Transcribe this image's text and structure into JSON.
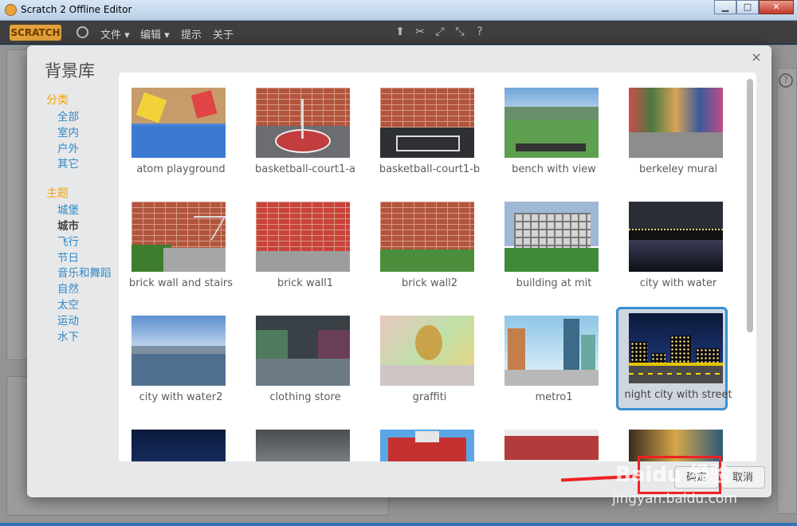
{
  "window": {
    "title": "Scratch 2 Offline Editor",
    "min": "▁",
    "max": "□",
    "close": "✕"
  },
  "menubar": {
    "logo": "SCRATCH",
    "items": [
      "文件 ▾",
      "编辑 ▾",
      "提示",
      "关于"
    ]
  },
  "dialog": {
    "title": "背景库",
    "close": "×",
    "categories_header": "分类",
    "categories": [
      "全部",
      "室内",
      "户外",
      "其它"
    ],
    "themes_header": "主题",
    "themes": [
      "城堡",
      "城市",
      "飞行",
      "节日",
      "音乐和舞蹈",
      "自然",
      "太空",
      "运动",
      "水下"
    ],
    "active_theme": "城市",
    "ok_label": "确定",
    "cancel_label": "取消"
  },
  "tiles": [
    {
      "label": "atom playground"
    },
    {
      "label": "basketball-court1-a"
    },
    {
      "label": "basketball-court1-b"
    },
    {
      "label": "bench with view"
    },
    {
      "label": "berkeley mural"
    },
    {
      "label": "brick wall and stairs"
    },
    {
      "label": "brick wall1"
    },
    {
      "label": "brick wall2"
    },
    {
      "label": "building at mit"
    },
    {
      "label": "city with water"
    },
    {
      "label": "city with water2"
    },
    {
      "label": "clothing store"
    },
    {
      "label": "graffiti"
    },
    {
      "label": "metro1"
    },
    {
      "label": "night city with street"
    }
  ],
  "selected_tile": "night city with street",
  "help": "?",
  "watermark": "Baidu 经验",
  "watermark_sub": "jingyan.baidu.com",
  "colors": {
    "category_header": "#f4a30a",
    "link": "#2e88c8",
    "selection_border": "#3a8fd0",
    "annotation": "#ee2222"
  }
}
